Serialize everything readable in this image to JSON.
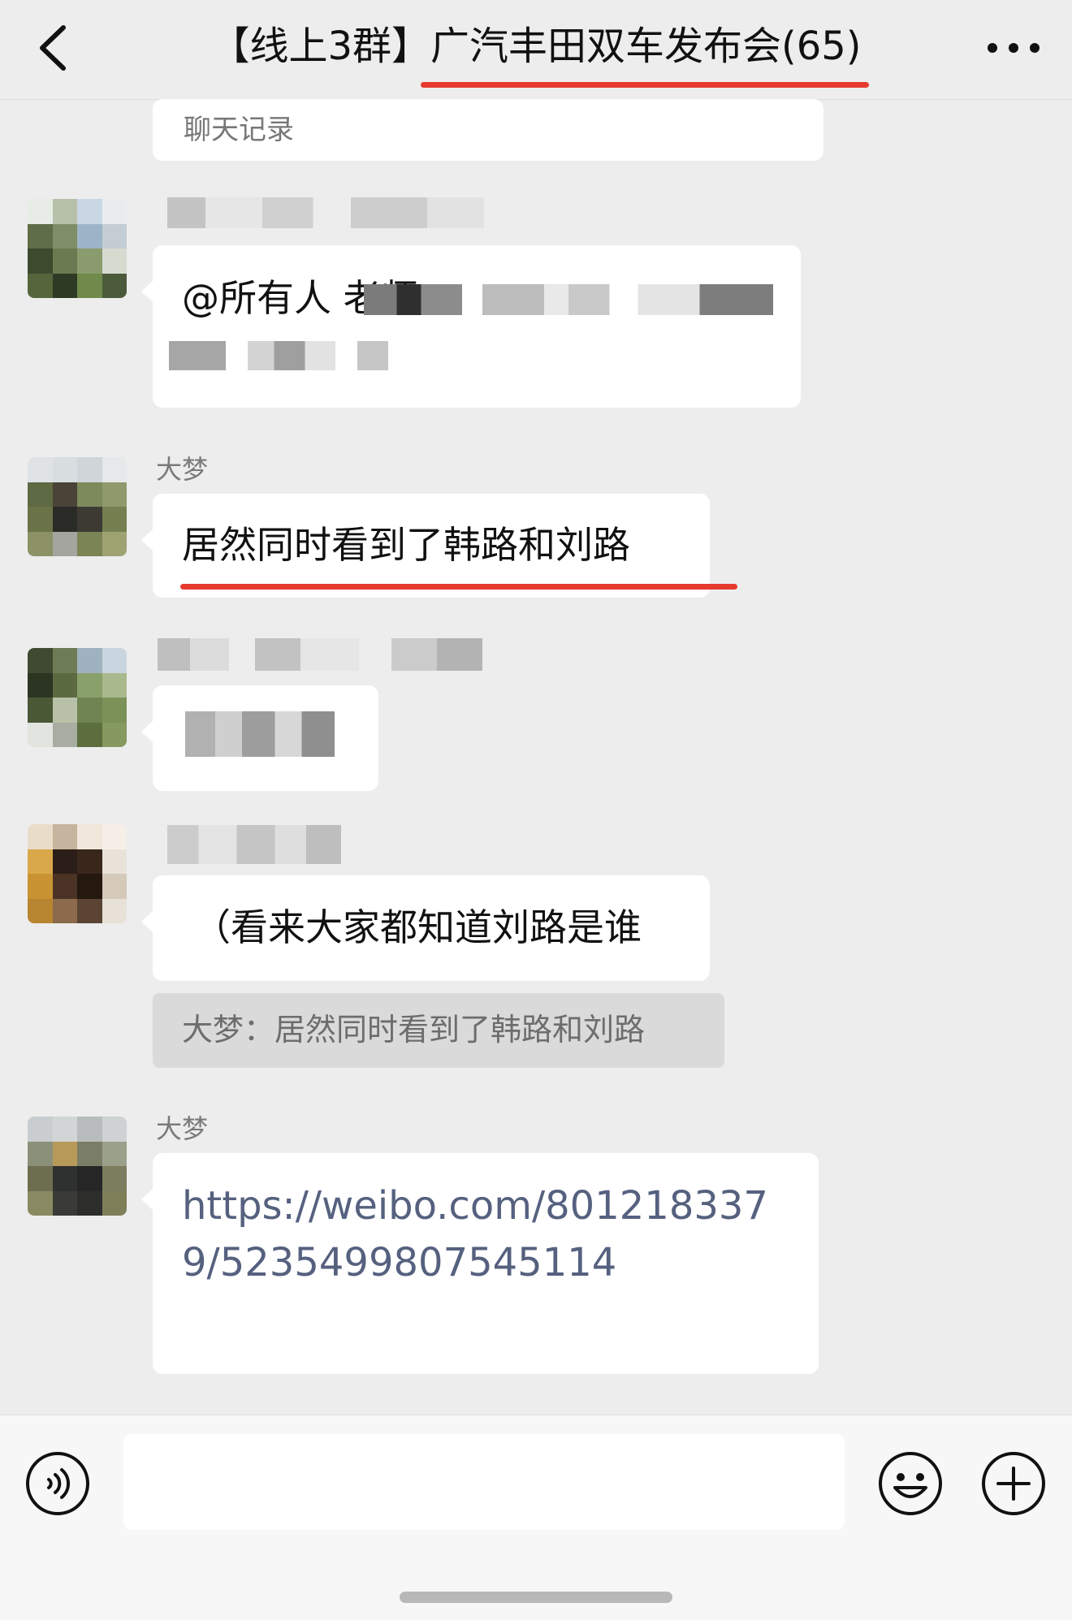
{
  "header": {
    "title": "【线上3群】广汽丰田双车发布会(65)",
    "back_icon": "chevron-left-icon",
    "more_icon": "more-dots-icon"
  },
  "messages": [
    {
      "type": "card",
      "text": "聊天记录"
    },
    {
      "type": "text",
      "sender": "",
      "text": "@所有人 老师",
      "redacted": true
    },
    {
      "type": "text",
      "sender": "大梦",
      "text": "居然同时看到了韩路和刘路"
    },
    {
      "type": "text",
      "sender": "",
      "text": "",
      "redacted": true
    },
    {
      "type": "text",
      "sender": "",
      "text": "（看来大家都知道刘路是谁",
      "quote": "大梦：居然同时看到了韩路和刘路"
    },
    {
      "type": "link",
      "sender": "大梦",
      "text": "https://weibo.com/8012183379/5235499807545114"
    }
  ],
  "input_bar": {
    "voice_icon": "voice-icon",
    "emoji_icon": "emoji-icon",
    "plus_icon": "plus-icon",
    "placeholder": ""
  },
  "colors": {
    "background": "#ededed",
    "bubble": "#ffffff",
    "highlight_underline": "#e63a2e",
    "link": "#56617f"
  }
}
